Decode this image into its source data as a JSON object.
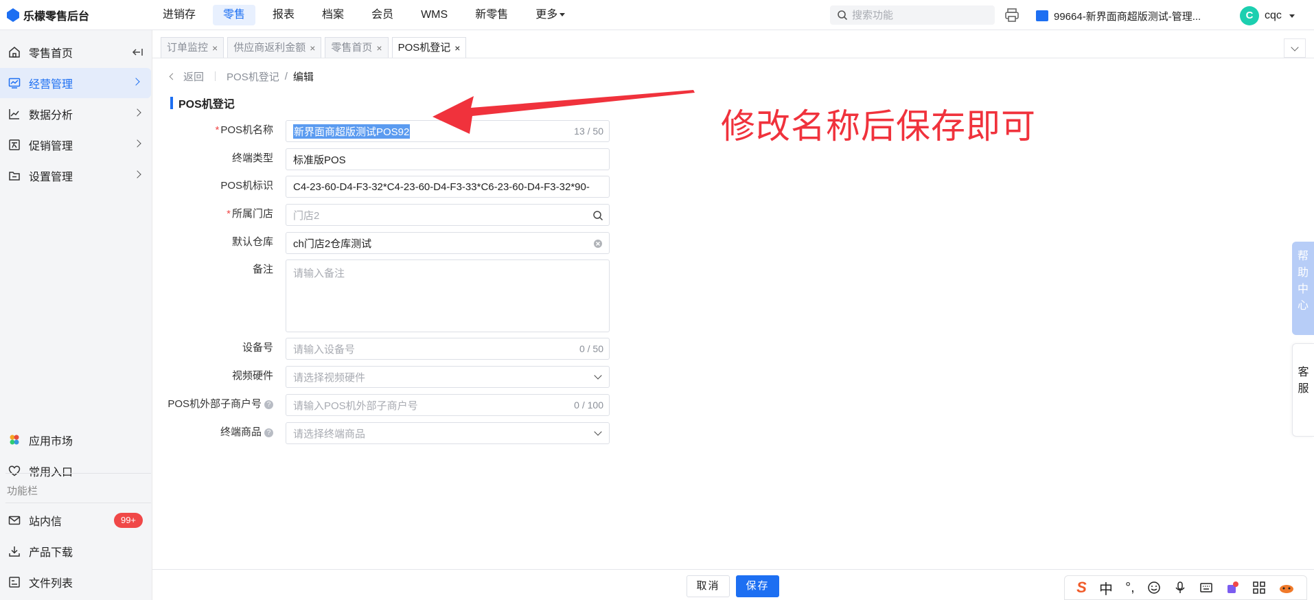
{
  "app": {
    "brand": "乐檬零售后台"
  },
  "topnav": {
    "items": [
      "进销存",
      "零售",
      "报表",
      "档案",
      "会员",
      "WMS",
      "新零售",
      "更多"
    ],
    "active_index": 1,
    "search_placeholder": "搜索功能",
    "org_label": "99664-新界面商超版测试-管理...",
    "user_initial": "C",
    "user_name": "cqc"
  },
  "sidebar": {
    "items": [
      {
        "label": "零售首页",
        "icon": "home-icon"
      },
      {
        "label": "经营管理",
        "icon": "trend-chart-icon"
      },
      {
        "label": "数据分析",
        "icon": "line-chart-icon"
      },
      {
        "label": "促销管理",
        "icon": "promotion-icon"
      },
      {
        "label": "设置管理",
        "icon": "folder-icon"
      }
    ],
    "active_index": 1,
    "bottom_items": [
      {
        "label": "应用市场",
        "icon": "app-market-icon"
      },
      {
        "label": "常用入口",
        "icon": "heart-icon"
      }
    ],
    "section_label": "功能栏",
    "tools": [
      {
        "label": "站内信",
        "icon": "mail-icon",
        "badge": "99+"
      },
      {
        "label": "产品下载",
        "icon": "download-icon"
      },
      {
        "label": "文件列表",
        "icon": "file-list-icon"
      }
    ]
  },
  "tabs": [
    {
      "label": "订单监控",
      "active": false
    },
    {
      "label": "供应商返利金额",
      "active": false
    },
    {
      "label": "零售首页",
      "active": false
    },
    {
      "label": "POS机登记",
      "active": true
    }
  ],
  "tab_close": "×",
  "breadcrumb": {
    "back": "返回",
    "parent": "POS机登记",
    "sep": "/",
    "current": "编辑"
  },
  "section_title": "POS机登记",
  "form": {
    "pos_name": {
      "label": "POS机名称",
      "required": true,
      "value": "新界面商超版测试POS92",
      "count": "13 / 50"
    },
    "terminal_type": {
      "label": "终端类型",
      "value": "标准版POS"
    },
    "pos_id": {
      "label": "POS机标识",
      "value": "C4-23-60-D4-F3-32*C4-23-60-D4-F3-33*C6-23-60-D4-F3-32*90-"
    },
    "store": {
      "label": "所属门店",
      "required": true,
      "placeholder": "门店2"
    },
    "warehouse": {
      "label": "默认仓库",
      "value": "ch门店2仓库测试"
    },
    "remark": {
      "label": "备注",
      "placeholder": "请输入备注"
    },
    "device_no": {
      "label": "设备号",
      "placeholder": "请输入设备号",
      "count": "0 / 50"
    },
    "video_hw": {
      "label": "视频硬件",
      "placeholder": "请选择视频硬件"
    },
    "sub_merchant": {
      "label": "POS机外部子商户号",
      "placeholder": "请输入POS机外部子商户号",
      "count": "0 / 100",
      "help": "?"
    },
    "terminal_goods": {
      "label": "终端商品",
      "placeholder": "请选择终端商品",
      "help": "?"
    }
  },
  "annotation": {
    "text": "修改名称后保存即可",
    "color": "#f0323c"
  },
  "float": {
    "help_center": [
      "帮",
      "助",
      "中",
      "心"
    ],
    "service": [
      "客",
      "服"
    ]
  },
  "footer": {
    "cancel": "取消",
    "save": "保存"
  },
  "ime": {
    "logo": "S",
    "lang": "中",
    "punct": "°,"
  },
  "colors": {
    "accent": "#1d6ff2",
    "danger": "#f04848",
    "annotation": "#f0323c"
  }
}
